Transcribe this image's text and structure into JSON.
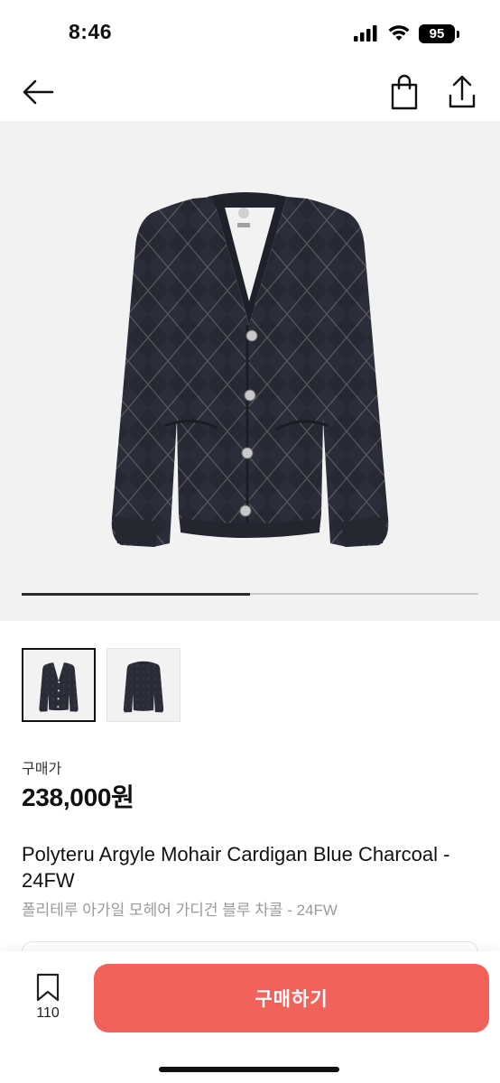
{
  "status": {
    "time": "8:46",
    "battery": "95"
  },
  "icons": {
    "back": "arrow-left-icon",
    "bag": "shopping-bag-icon",
    "share": "share-icon",
    "bookmark": "bookmark-icon"
  },
  "gallery": {
    "current_index": 1,
    "total": 2,
    "progress": 0.5
  },
  "product": {
    "price_label": "구매가",
    "price": "238,000원",
    "title": "Polyteru Argyle Mohair Cardigan Blue Charcoal - 24FW",
    "subtitle": "폴리테루 아가일 모헤어 가디건 블루 차콜 - 24FW"
  },
  "actions": {
    "bookmark_count": "110",
    "buy_label": "구매하기"
  },
  "colors": {
    "accent": "#f0625a",
    "hero_bg": "#f2f2f3",
    "garment": "#2a2d38"
  }
}
